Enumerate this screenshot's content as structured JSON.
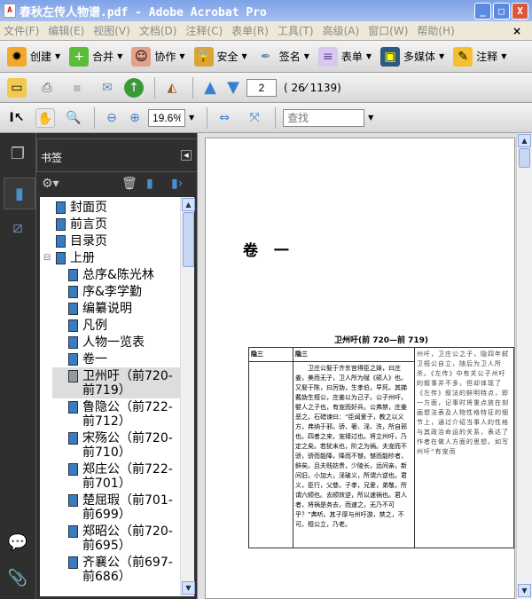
{
  "window": {
    "title": "春秋左传人物谱.pdf - Adobe Acrobat Pro",
    "minimize": "_",
    "maximize": "□",
    "close": "X"
  },
  "menu": [
    "文件(F)",
    "编辑(E)",
    "视图(V)",
    "文档(D)",
    "注释(C)",
    "表单(R)",
    "工具(T)",
    "高级(A)",
    "窗口(W)",
    "帮助(H)"
  ],
  "menu_close": "×",
  "toolbar1": [
    {
      "label": "创建",
      "icon": "create-icon"
    },
    {
      "label": "合并",
      "icon": "combine-icon"
    },
    {
      "label": "协作",
      "icon": "collaborate-icon"
    },
    {
      "label": "安全",
      "icon": "lock-icon"
    },
    {
      "label": "签名",
      "icon": "pen-icon"
    },
    {
      "label": "表单",
      "icon": "form-icon"
    },
    {
      "label": "多媒体",
      "icon": "multimedia-icon"
    },
    {
      "label": "注释",
      "icon": "comment-icon"
    }
  ],
  "navigation": {
    "page_input": "2",
    "page_info": "( 26⁄ 1139)"
  },
  "zoom": {
    "value": "19.6%"
  },
  "find": {
    "placeholder": "查找"
  },
  "bookmarks": {
    "title": "书签",
    "items": [
      {
        "label": "封面页",
        "level": 0
      },
      {
        "label": "前言页",
        "level": 0
      },
      {
        "label": "目录页",
        "level": 0
      },
      {
        "label": "上册",
        "level": 0,
        "expanded": true
      },
      {
        "label": "总序&陈光林",
        "level": 1
      },
      {
        "label": "序&李学勤",
        "level": 1
      },
      {
        "label": "编纂说明",
        "level": 1
      },
      {
        "label": "凡例",
        "level": 1
      },
      {
        "label": "人物一览表",
        "level": 1
      },
      {
        "label": "卷一",
        "level": 1
      },
      {
        "label": "卫州吁（前720-前719）",
        "level": 1,
        "selected": true
      },
      {
        "label": "鲁隐公（前722-前712）",
        "level": 1
      },
      {
        "label": "宋殇公（前720-前710）",
        "level": 1
      },
      {
        "label": "郑庄公（前722-前701）",
        "level": 1
      },
      {
        "label": "楚屈瑕（前701-前699）",
        "level": 1
      },
      {
        "label": "郑昭公（前720-前695）",
        "level": 1
      },
      {
        "label": "齐襄公（前697-前686）",
        "level": 1
      }
    ]
  },
  "page": {
    "chapter": "卷 一",
    "heading": "卫州吁(前 720—前 719)",
    "col1_head": "隐三",
    "col2_head": "隐三",
    "body": "卫庄公娶于齐东宫得臣之妹，曰庄姜，美而无子，卫人所为赋《硕人》也。又娶于陈，曰厉妫，生孝伯，早死。其娣戴妫生桓公，庄姜以为己子。公子州吁，嬖人之子也，有宠而好兵。公弗禁，庄姜恶之。石碏谏曰：“臣闻爱子，教之以义方，弗纳于邪。骄、奢、淫、泆，所自邪也。四者之来，宠禄过也。将立州吁，乃定之矣。若犹未也，阶之为祸。夫宠而不骄，骄而能降，降而不憾，憾而能眕者，鲜矣。且夫贱妨贵，少陵长，远间亲，新间旧，小加大，淫破义，所谓六逆也。君义，臣行，父慈，子孝，兄爱，弟敬，所谓六顺也。去顺效逆，所以速祸也。君人者，将祸是务去，而速之，无乃不可乎？”弗听。其子厚与州吁游，禁之，不可。桓公立，乃老。",
    "note": "州吁，卫庄公之子，隐四年弑卫桓公自立，随后为卫人所杀。《左传》中有关公子州吁的叙事并不多，但却体现了《左传》叙法的鲜明特点，即一方面，记事时将重点放在刻画想法表及人物性格特征的细节上，通过介绍当事人的性格与其政治命运的关系，表达了作者在做人方面的思想。如写州吁“有宠而"
  }
}
